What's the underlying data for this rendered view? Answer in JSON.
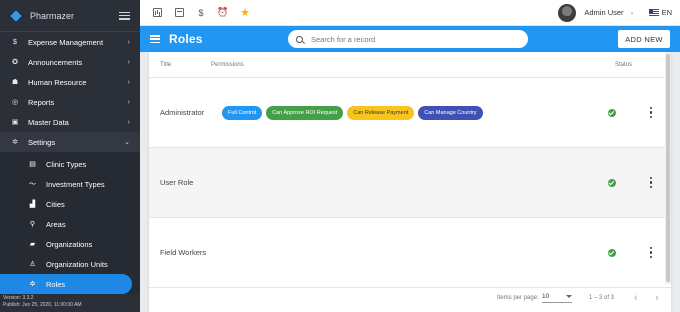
{
  "app": {
    "name": "Pharmazer"
  },
  "sidebar": {
    "items": [
      {
        "label": "Expense Management",
        "icon": "dollar-icon"
      },
      {
        "label": "Announcements",
        "icon": "megaphone-icon"
      },
      {
        "label": "Human Resource",
        "icon": "people-icon"
      },
      {
        "label": "Reports",
        "icon": "reports-icon"
      },
      {
        "label": "Master Data",
        "icon": "database-icon"
      },
      {
        "label": "Settings",
        "icon": "gear-icon"
      }
    ],
    "settings_children": [
      {
        "label": "Clinic Types",
        "icon": "clinic-icon"
      },
      {
        "label": "Investment Types",
        "icon": "trend-icon"
      },
      {
        "label": "Cities",
        "icon": "city-icon"
      },
      {
        "label": "Areas",
        "icon": "pin-icon"
      },
      {
        "label": "Organizations",
        "icon": "briefcase-icon"
      },
      {
        "label": "Organization Units",
        "icon": "hierarchy-icon"
      },
      {
        "label": "Roles",
        "icon": "gear-icon"
      }
    ],
    "active_item": "Roles",
    "version": "Version: 3.3.2",
    "published": "Publish: Jun 25, 2020, 11:00:00 AM"
  },
  "topbar": {
    "user_name": "Admin User",
    "language": "EN"
  },
  "header": {
    "title": "Roles",
    "search_placeholder": "Search for a record",
    "add_button": "ADD NEW"
  },
  "table": {
    "columns": {
      "title": "Title",
      "permissions": "Permissions",
      "status": "Status"
    },
    "rows": [
      {
        "title": "Administrator",
        "permissions": [
          {
            "label": "Full Control",
            "color": "#2196f3"
          },
          {
            "label": "Can Approve ROI Request",
            "color": "#43a047"
          },
          {
            "label": "Can Release Payment",
            "color": "#f9c51d"
          },
          {
            "label": "Can Manage Country",
            "color": "#3f51b5"
          }
        ],
        "status": "active"
      },
      {
        "title": "User Role",
        "permissions": [],
        "status": "active"
      },
      {
        "title": "Field Workers",
        "permissions": [],
        "status": "active"
      }
    ]
  },
  "paginator": {
    "items_per_page_label": "Items per page:",
    "page_size": "10",
    "range": "1 – 3 of 3"
  },
  "colors": {
    "primary": "#2196f3",
    "sidebar": "#2b2f38",
    "success": "#43a047",
    "star": "#f5b400"
  }
}
